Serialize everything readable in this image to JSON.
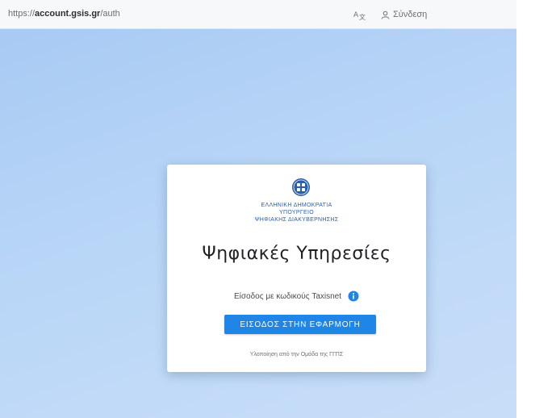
{
  "browser": {
    "url_prefix": "https://",
    "url_domain": "account.gsis.gr",
    "url_rest": "/auth",
    "login_label": "Σύνδεση"
  },
  "card": {
    "ministry_lines": [
      "ΕΛΛΗΝΙΚΗ ΔΗΜΟΚΡΑΤΙΑ",
      "ΥΠΟΥΡΓΕΙΟ",
      "ΨΗΦΙΑΚΗΣ ΔΙΑΚΥΒΕΡΝΗΣΗΣ"
    ],
    "title": "Ψηφιακές Υπηρεσίες",
    "sso_text": "Είσοδος με κωδικούς Taxisnet",
    "button_label": "ΕΙΣΟΔΟΣ ΣΤΗΝ ΕΦΑΡΜΟΓΗ",
    "footer_text": "Υλοποίηση από την Ομάδα της ΓΓΠΣ"
  },
  "colors": {
    "accent": "#1f86e8",
    "ministry_text": "#2b5fa6",
    "hero_bg": "#b9d6f7"
  },
  "icons": {
    "translate": "translate-icon",
    "user": "user-icon",
    "emblem": "emblem-icon",
    "info": "info-icon"
  }
}
